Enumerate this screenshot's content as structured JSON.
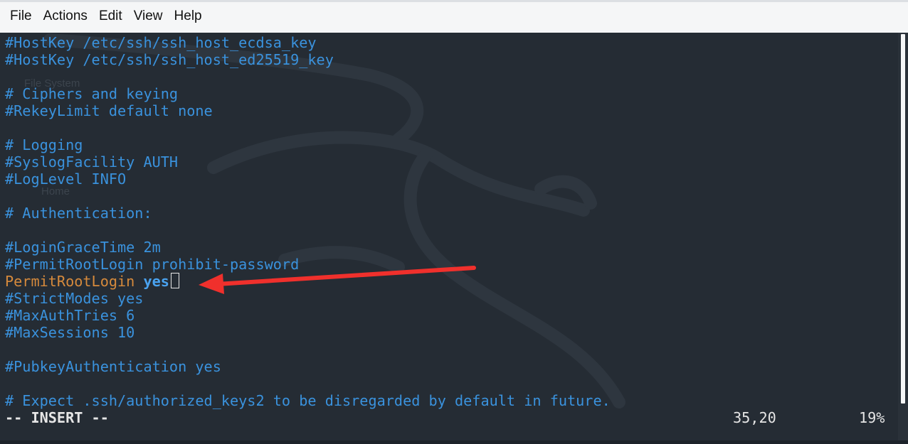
{
  "menubar": {
    "items": [
      "File",
      "Actions",
      "Edit",
      "View",
      "Help"
    ]
  },
  "background": {
    "ghost_labels": [
      "File System",
      "Home"
    ]
  },
  "editor": {
    "lines": [
      "#HostKey /etc/ssh/ssh_host_ecdsa_key",
      "#HostKey /etc/ssh/ssh_host_ed25519_key",
      "",
      "# Ciphers and keying",
      "#RekeyLimit default none",
      "",
      "# Logging",
      "#SyslogFacility AUTH",
      "#LogLevel INFO",
      "",
      "# Authentication:",
      "",
      "#LoginGraceTime 2m",
      "#PermitRootLogin prohibit-password",
      "__ACTIVE__",
      "#StrictModes yes",
      "#MaxAuthTries 6",
      "#MaxSessions 10",
      "",
      "#PubkeyAuthentication yes",
      "",
      "# Expect .ssh/authorized_keys2 to be disregarded by default in future."
    ],
    "active_line": {
      "keyword": "PermitRootLogin",
      "value": "yes"
    }
  },
  "status": {
    "mode": "-- INSERT --",
    "position": "35,20",
    "percent": "19%"
  },
  "colors": {
    "comment": "#3a92dd",
    "keyword": "#d68a3c",
    "value": "#4aa3f0",
    "annotation_arrow": "#f0302c"
  }
}
